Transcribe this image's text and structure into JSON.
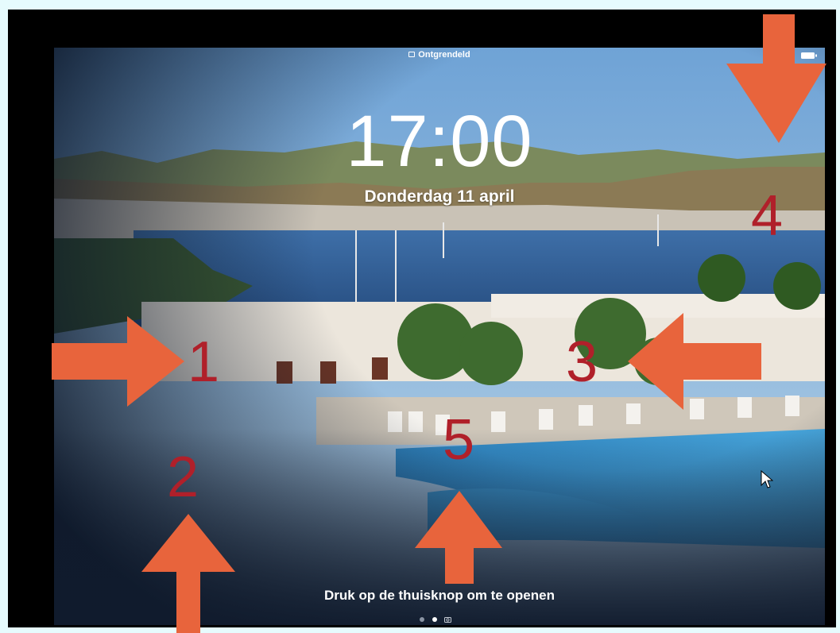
{
  "status_bar": {
    "lock_text": "Ontgrendeld"
  },
  "lock_screen": {
    "time": "17:00",
    "date": "Donderdag 11 april",
    "unlock_hint": "Druk op de thuisknop om te openen",
    "page_dots": {
      "count": 2,
      "active_index": 1,
      "camera_page": true
    }
  },
  "annotations": {
    "arrow_color": "#e8643c",
    "number_color": "#b0202a",
    "markers": [
      "1",
      "2",
      "3",
      "4",
      "5"
    ]
  }
}
